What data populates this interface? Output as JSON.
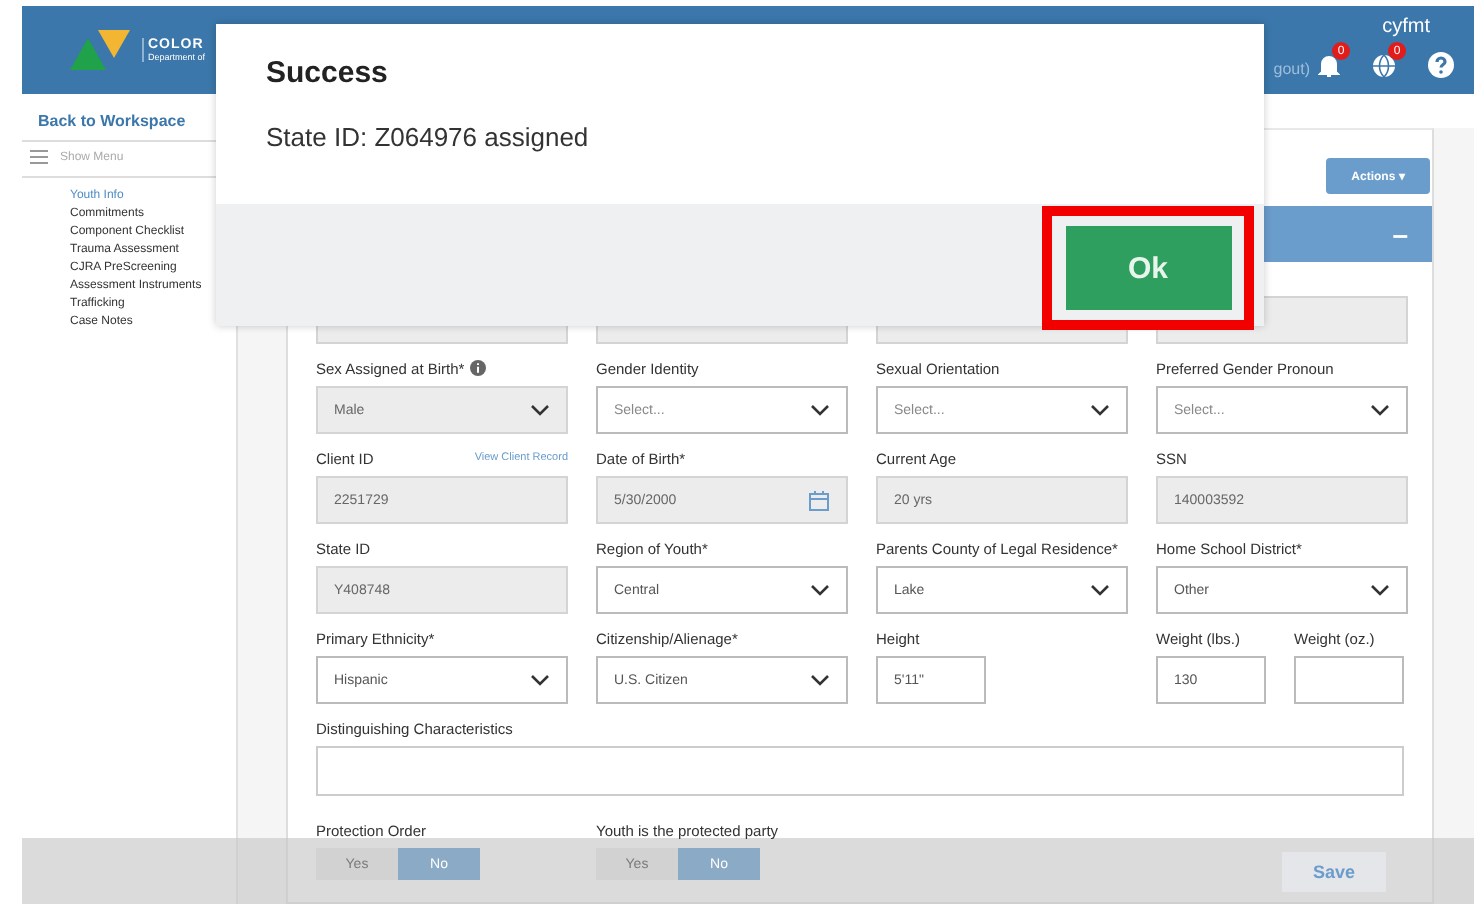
{
  "header": {
    "brand": "COLOR",
    "brand_sub": "Department of",
    "logout_fragment": "gout)",
    "user": "cyfmt",
    "notifications": [
      {
        "kind": "bell",
        "count": "0"
      },
      {
        "kind": "globe",
        "count": "0"
      }
    ]
  },
  "sidebar": {
    "back_link": "Back to Workspace",
    "menu_toggle": "Show Menu",
    "items": [
      {
        "label": "Youth Info",
        "selected": true
      },
      {
        "label": "Commitments",
        "selected": false
      },
      {
        "label": "Component Checklist",
        "selected": false
      },
      {
        "label": "Trauma Assessment",
        "selected": false
      },
      {
        "label": "CJRA PreScreening",
        "selected": false
      },
      {
        "label": "Assessment Instruments",
        "selected": false
      },
      {
        "label": "Trafficking",
        "selected": false
      },
      {
        "label": "Case Notes",
        "selected": false
      }
    ]
  },
  "actions_button": "Actions ▾",
  "section_collapse": "–",
  "form": {
    "rows": [
      [
        {
          "label": "Sex Assigned at Birth*",
          "info": true,
          "kind": "select",
          "value": "Male",
          "readonly": true
        },
        {
          "label": "Gender Identity",
          "kind": "select",
          "placeholder": "Select...",
          "readonly": false
        },
        {
          "label": "Sexual Orientation",
          "kind": "select",
          "placeholder": "Select...",
          "readonly": false
        },
        {
          "label": "Preferred Gender Pronoun",
          "kind": "select",
          "placeholder": "Select...",
          "readonly": false
        }
      ],
      [
        {
          "label": "Client ID",
          "link": "View Client Record",
          "kind": "text",
          "value": "2251729",
          "readonly": true
        },
        {
          "label": "Date of Birth*",
          "kind": "date",
          "value": "5/30/2000",
          "readonly": true
        },
        {
          "label": "Current Age",
          "kind": "text",
          "value": "20 yrs",
          "readonly": true
        },
        {
          "label": "SSN",
          "kind": "text",
          "value": "140003592",
          "readonly": true
        }
      ],
      [
        {
          "label": "State ID",
          "kind": "text",
          "value": "Y408748",
          "readonly": true
        },
        {
          "label": "Region of Youth*",
          "kind": "select",
          "value": "Central",
          "readonly": false
        },
        {
          "label": "Parents County of Legal Residence*",
          "kind": "select",
          "value": "Lake",
          "readonly": false
        },
        {
          "label": "Home School District*",
          "kind": "select",
          "value": "Other",
          "readonly": false
        }
      ],
      [
        {
          "label": "Primary Ethnicity*",
          "kind": "select",
          "value": "Hispanic",
          "readonly": false
        },
        {
          "label": "Citizenship/Alienage*",
          "kind": "select",
          "value": "U.S. Citizen",
          "readonly": false
        },
        {
          "label": "Height",
          "kind": "short",
          "value": "5'11\"",
          "readonly": false
        },
        {
          "kind": "pair",
          "parts": [
            {
              "label": "Weight (lbs.)",
              "value": "130"
            },
            {
              "label": "Weight (oz.)"
            }
          ]
        }
      ]
    ],
    "textarea_label": "Distinguishing Characteristics",
    "toggles": [
      {
        "label": "Protection Order",
        "options": [
          {
            "label": "Yes",
            "selected": false
          },
          {
            "label": "No",
            "selected": true
          }
        ]
      },
      {
        "label": "Youth is the protected party",
        "options": [
          {
            "label": "Yes",
            "selected": false
          },
          {
            "label": "No",
            "selected": true
          }
        ]
      }
    ]
  },
  "save_button": "Save",
  "modal": {
    "title": "Success",
    "message": "State ID: Z064976 assigned",
    "ok_button": "Ok",
    "ok_highlighted": true
  }
}
